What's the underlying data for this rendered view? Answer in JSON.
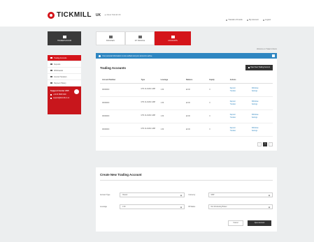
{
  "header": {
    "brand": "TICKMILL",
    "region": "UK",
    "regulation_note": "▲ About Tickmill UK",
    "links": [
      "Transfer of Funds",
      "My Account",
      "Logout"
    ]
  },
  "nav": {
    "items": [
      {
        "label": "TRADER'S ROOM"
      },
      {
        "label": "BONUSES"
      },
      {
        "label": "MY PROFILE"
      },
      {
        "label": "ACCOUNTS"
      }
    ]
  },
  "sidebar": {
    "items": [
      {
        "label": "Trading Accounts"
      },
      {
        "label": "Deposits"
      },
      {
        "label": "Withdrawals"
      },
      {
        "label": "Internal Transfers"
      },
      {
        "label": "Payment History"
      }
    ],
    "support": {
      "title": "Support Center 24/5",
      "phone": "+44 20 3608 6100",
      "email": "support@tickmill.co.uk"
    }
  },
  "main": {
    "hint": "Welcome to Trader's Room",
    "banner": "Your personal information is now verified and your account is active.",
    "title": "Trading Accounts",
    "open_button": "Open New Trading Account",
    "columns": [
      "Account Number",
      "Type",
      "Leverage",
      "Balance",
      "Equity",
      "Actions"
    ],
    "rows": [
      {
        "account": "00000000",
        "type": "MT4 CLASSIC GBP",
        "leverage": "1:30",
        "balance": "£0.00",
        "equity": "0",
        "actions": [
          "Deposit",
          "Withdraw",
          "Transfer",
          "Settings"
        ]
      },
      {
        "account": "00000000",
        "type": "MT4 CLASSIC GBP",
        "leverage": "1:30",
        "balance": "£0.00",
        "equity": "0",
        "actions": [
          "Deposit",
          "Withdraw",
          "Transfer",
          "Settings"
        ]
      },
      {
        "account": "00000000",
        "type": "MT4 CLASSIC GBP",
        "leverage": "1:30",
        "balance": "£0.00",
        "equity": "0",
        "actions": [
          "Deposit",
          "Withdraw",
          "Transfer",
          "Settings"
        ]
      },
      {
        "account": "00000000",
        "type": "MT4 CLASSIC GBP",
        "leverage": "1:30",
        "balance": "£0.00",
        "equity": "0",
        "actions": [
          "Deposit",
          "Withdraw",
          "Transfer",
          "Settings"
        ]
      }
    ],
    "pager": [
      "‹",
      "1",
      "›"
    ]
  },
  "create": {
    "title": "Create New Trading Account",
    "account_type_label": "Account Type",
    "account_type_value": "Classic",
    "currency_label": "Currency",
    "currency_value": "GBP",
    "leverage_label": "Leverage",
    "leverage_value": "1:30",
    "ib_label": "IB Status",
    "ib_value": "Not Introducing Broker",
    "cancel_button": "Cancel",
    "submit_button": "Open Account"
  }
}
